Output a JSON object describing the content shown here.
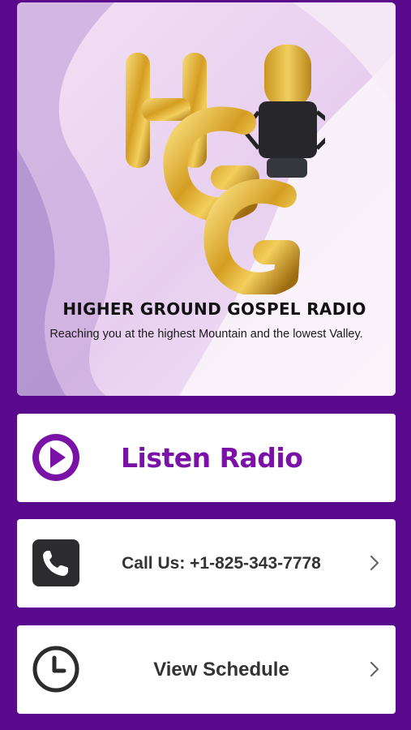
{
  "banner": {
    "logo_letters": "HGG",
    "title": "HIGHER GROUND GOSPEL RADIO",
    "tagline": "Reaching you at the highest Mountain and the lowest Valley."
  },
  "actions": {
    "listen": {
      "label": "Listen Radio",
      "icon": "play-icon"
    },
    "call": {
      "label": "Call Us: +1-825-343-7778",
      "icon": "phone-icon"
    },
    "schedule": {
      "label": "View Schedule",
      "icon": "clock-icon"
    }
  },
  "colors": {
    "background": "#5a0a8c",
    "accent": "#7a12a8",
    "card": "#ffffff",
    "gold": "#d4a32a"
  }
}
